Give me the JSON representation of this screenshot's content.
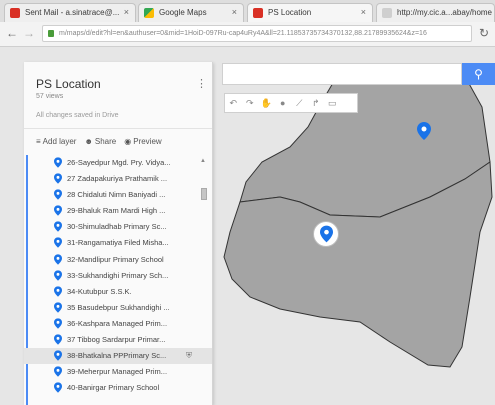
{
  "browser": {
    "tabs": [
      {
        "title": "Sent Mail - a.sinatrace@...",
        "icon": "gmail-icon",
        "active": false
      },
      {
        "title": "Google Maps",
        "icon": "maps-icon",
        "active": false
      },
      {
        "title": "PS Location",
        "icon": "mymaps-icon",
        "active": true
      },
      {
        "title": "http://my.cic.a...abay/home",
        "icon": "page-icon",
        "active": false
      }
    ],
    "url": "m/maps/d/edit?hl=en&authuser=0&mid=1HoiD-097Ru-cap4uRy4A&ll=21.11853735734370132,88.21789935624&z=16"
  },
  "map": {
    "search_placeholder": "",
    "tools": [
      "undo-icon",
      "redo-icon",
      "hand-icon",
      "marker-icon",
      "polyline-icon",
      "directions-icon",
      "ruler-icon"
    ],
    "fill_color": "#a4a4a4",
    "marker_color": "#1a73e8"
  },
  "panel": {
    "title": "PS Location",
    "views": "57 views",
    "saved": "All changes saved in Drive",
    "actions": {
      "add_layer": "Add layer",
      "share": "Share",
      "preview": "Preview"
    },
    "items": [
      "26-Sayedpur Mgd. Pry. Vidya...",
      "27 Zadapakuriya Prathamik ...",
      "28 Chidaluti Nimn Baniyadi ...",
      "29-Bhaluk Ram Mardi High ...",
      "30-Shimuladhab Primary Sc...",
      "31-Rangamatiya Filed Misha...",
      "32-Mandlipur Primary School",
      "33-Sukhandighi Primary Sch...",
      "34-Kutubpur S.S.K.",
      "35 Basudebpur Sukhandighi ...",
      "36-Kashpara Managed Prim...",
      "37 Tibbog Sardarpur Primar...",
      "38-Bhatkalna PPPrimary Sc...",
      "39-Meherpur Managed Prim...",
      "40-Banirgar Primary School"
    ],
    "selected_index": 12
  }
}
